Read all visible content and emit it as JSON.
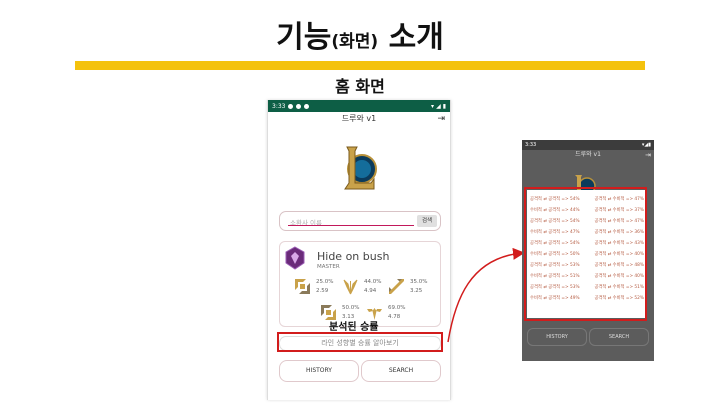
{
  "slide": {
    "title_main": "기능",
    "title_paren": "(화면)",
    "title_tail": " 소개",
    "section_label": "홈 화면"
  },
  "colors": {
    "accent_yellow": "#f4c20d",
    "status_green": "#0d5e45",
    "highlight_red": "#d21c1c"
  },
  "phone": {
    "status_time": "3:33",
    "app_title": "드루와 v1",
    "search_placeholder": "소환사 이름",
    "search_button": "검색",
    "summoner_name": "Hide on bush",
    "tier": "MASTER",
    "stats": [
      {
        "pct": "25.0%",
        "kda": "2.59"
      },
      {
        "pct": "44.0%",
        "kda": "4.94"
      },
      {
        "pct": "35.0%",
        "kda": "3.25"
      },
      {
        "pct": "50.0%",
        "kda": "3.13"
      },
      {
        "pct": "69.0%",
        "kda": "4.78"
      }
    ],
    "analyzed_label": "분석된 승률",
    "line_button": "라인 성향별 승률 알아보기",
    "history_button": "HISTORY",
    "search_nav_button": "SEARCH"
  },
  "phone2": {
    "status_time": "3:33",
    "app_title": "드루와 v1",
    "rows": [
      [
        "공격적 ⇄ 공격적 => 54%",
        "공격적 ⇄ 수비적 => 47%"
      ],
      [
        "수비적 ⇄ 공격적 => 44%",
        "공격적 ⇄ 수비적 => 37%"
      ],
      [
        "공격적 ⇄ 공격적 => 54%",
        "공격적 ⇄ 수비적 => 47%"
      ],
      [
        "수비적 ⇄ 공격적 => 47%",
        "공격적 ⇄ 수비적 => 36%"
      ],
      [
        "공격적 ⇄ 공격적 => 54%",
        "공격적 ⇄ 수비적 => 43%"
      ],
      [
        "수비적 ⇄ 공격적 => 50%",
        "공격적 ⇄ 수비적 => 40%"
      ],
      [
        "공격적 ⇄ 공격적 => 53%",
        "공격적 ⇄ 수비적 => 48%"
      ],
      [
        "수비적 ⇄ 공격적 => 51%",
        "공격적 ⇄ 수비적 => 40%"
      ],
      [
        "공격적 ⇄ 공격적 => 53%",
        "공격적 ⇄ 수비적 => 51%"
      ],
      [
        "수비적 ⇄ 공격적 => 49%",
        "공격적 ⇄ 수비적 => 52%"
      ]
    ],
    "history_button": "HISTORY",
    "search_nav_button": "SEARCH"
  }
}
